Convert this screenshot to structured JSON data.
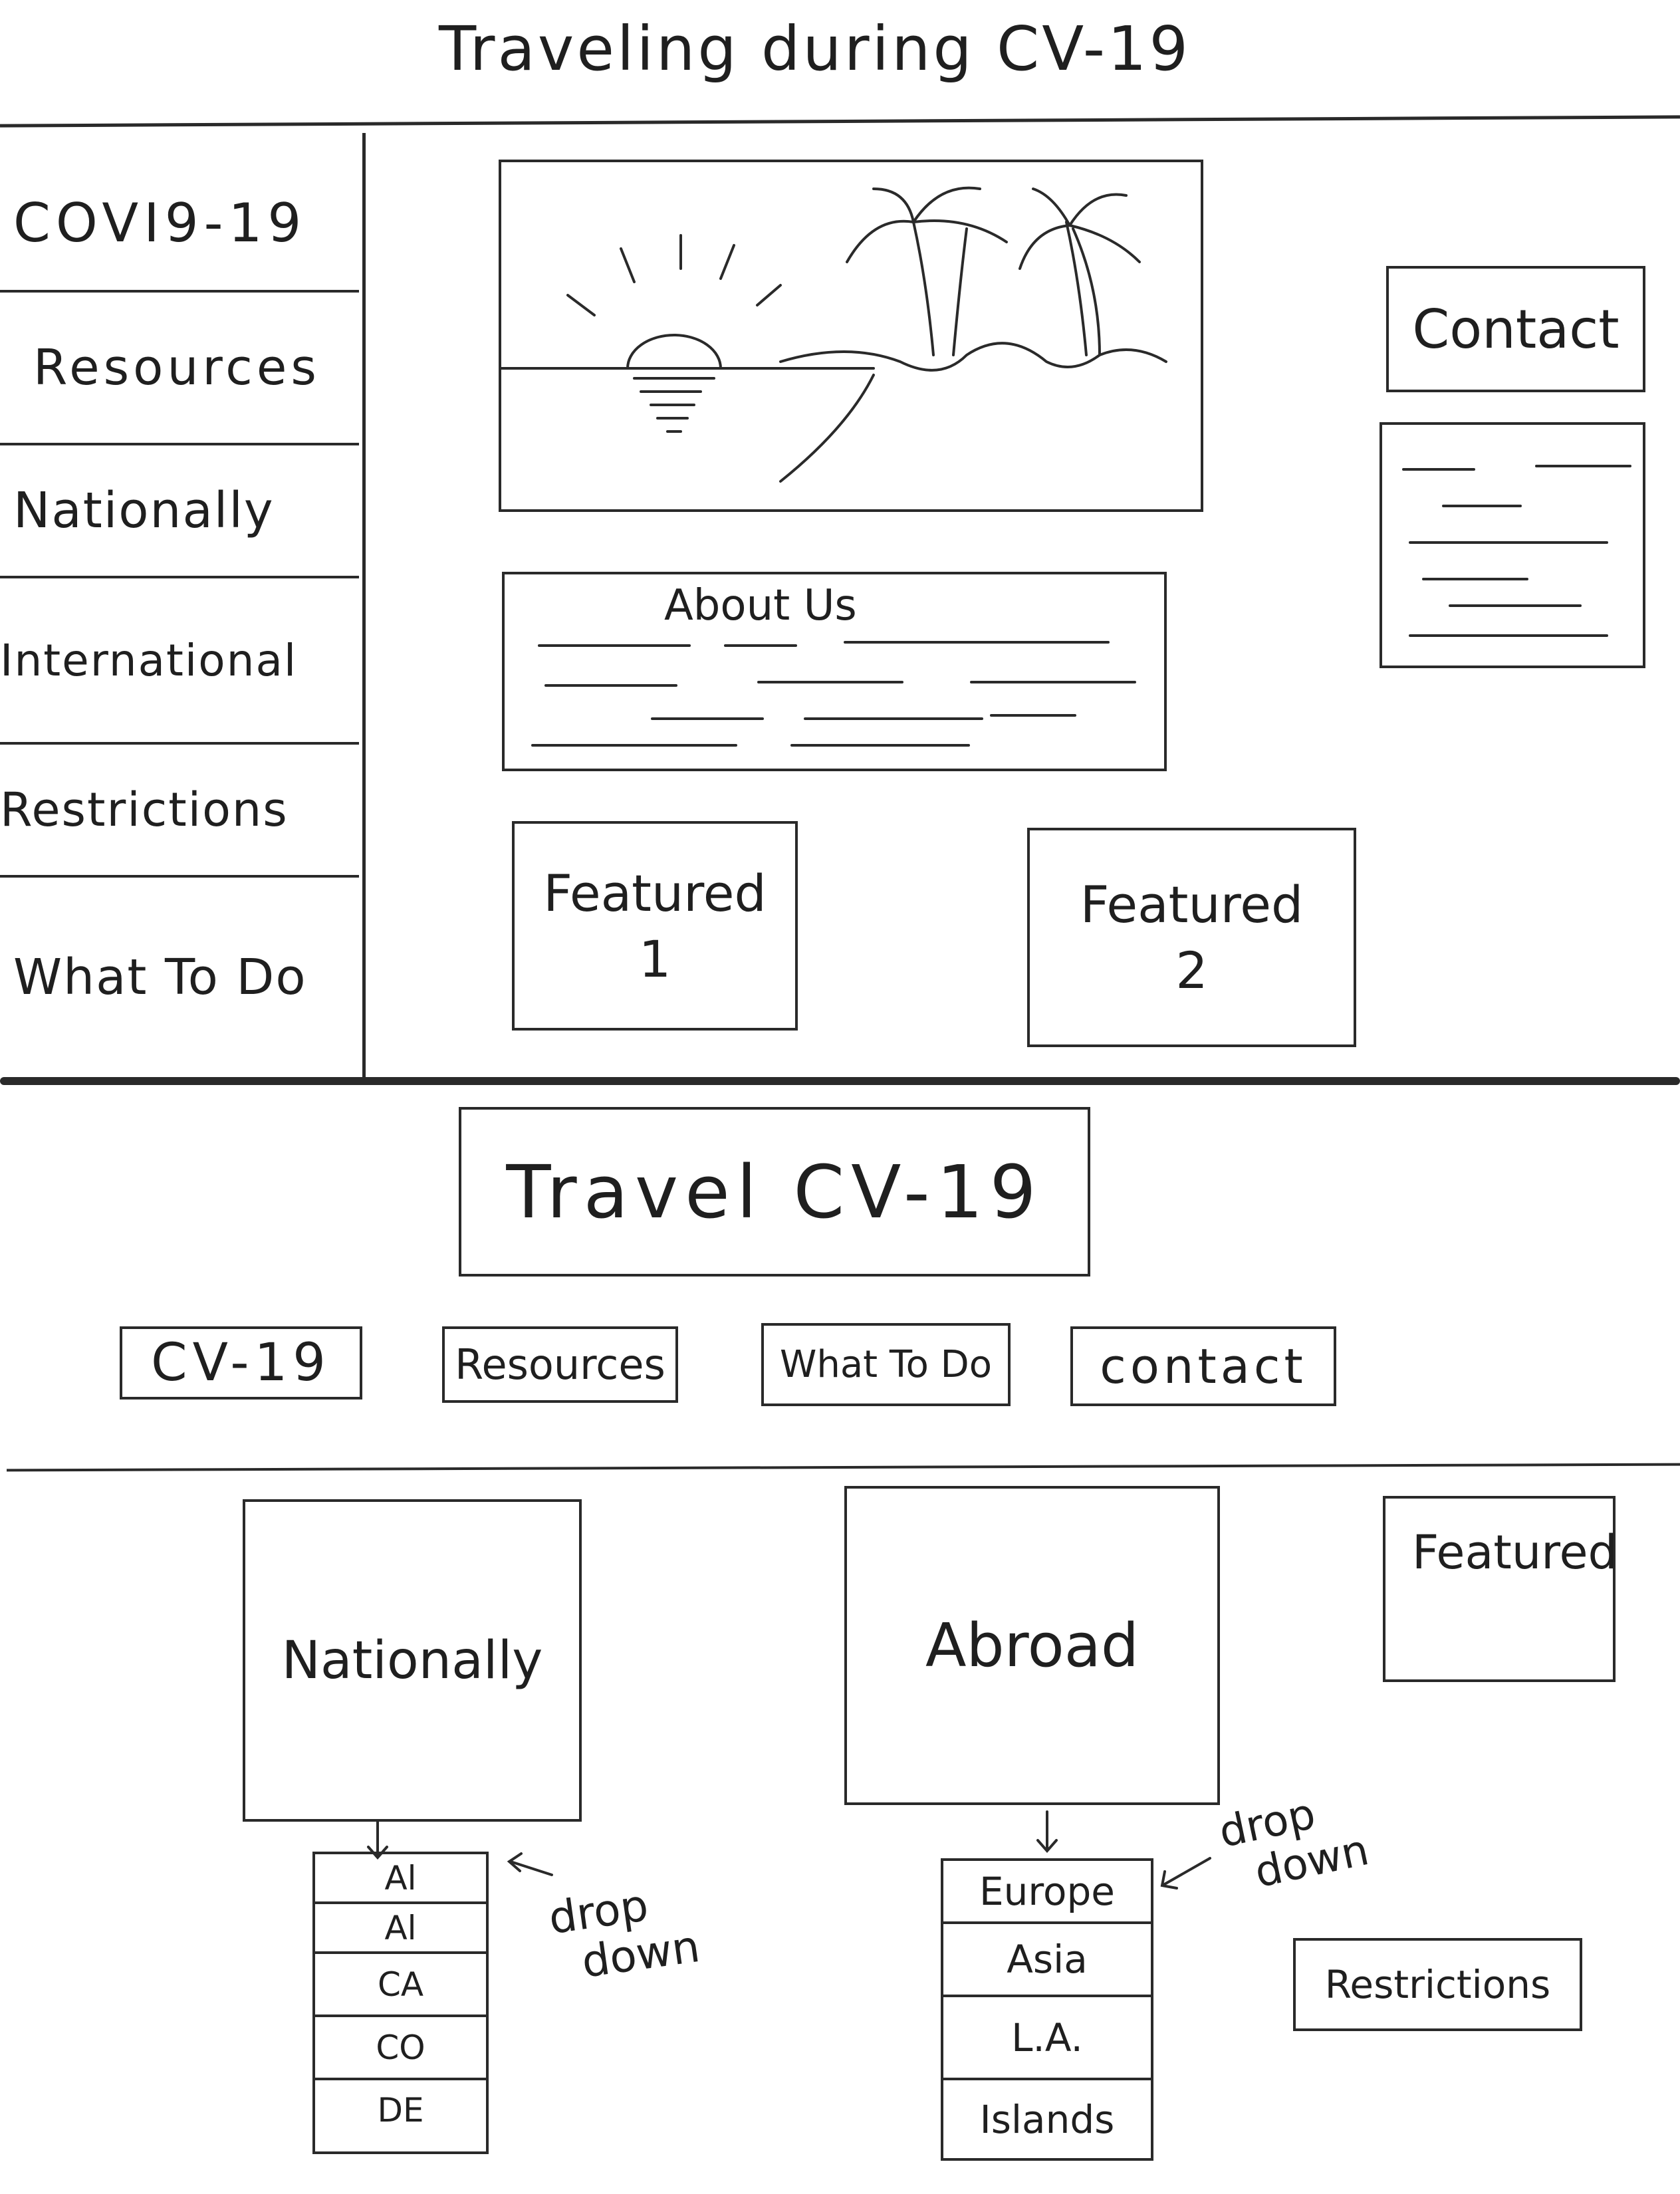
{
  "wireframe1": {
    "title": "Traveling during CV-19",
    "sidebar": {
      "items": [
        {
          "label": "COVI9-19"
        },
        {
          "label": "Resources"
        },
        {
          "label": "Nationally"
        },
        {
          "label": "International"
        },
        {
          "label": "Restrictions"
        },
        {
          "label": "What To Do"
        }
      ]
    },
    "hero_image": {
      "icon": "beach-sunset-palm-trees-sketch"
    },
    "about": {
      "heading": "About Us"
    },
    "featured_1": {
      "line1": "Featured",
      "line2": "1"
    },
    "featured_2": {
      "line1": "Featured",
      "line2": "2"
    },
    "contact": {
      "label": "Contact"
    }
  },
  "wireframe2": {
    "title": "Travel CV-19",
    "nav": [
      {
        "label": "CV-19"
      },
      {
        "label": "Resources"
      },
      {
        "label": "What To Do"
      },
      {
        "label": "contact"
      }
    ],
    "nationally": {
      "label": "Nationally",
      "dropdown": [
        "Al",
        "Al",
        "CA",
        "CO",
        "DE"
      ],
      "annotation": {
        "line1": "drop",
        "line2": "down"
      }
    },
    "abroad": {
      "label": "Abroad",
      "dropdown": [
        "Europe",
        "Asia",
        "L.A.",
        "Islands"
      ],
      "annotation": {
        "line1": "drop",
        "line2": "down"
      }
    },
    "featured": {
      "label": "Featured"
    },
    "restrictions": {
      "label": "Restrictions"
    }
  },
  "colors": {
    "ink": "#2a2a2a",
    "paper": "#ffffff"
  }
}
